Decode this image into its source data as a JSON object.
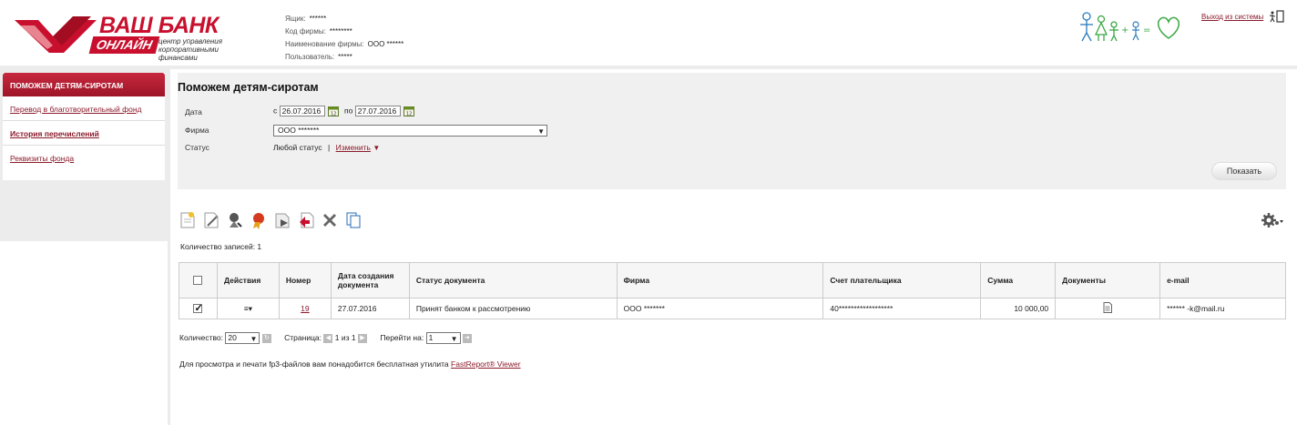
{
  "header": {
    "brand": "ВАШ БАНК",
    "brand_online": "ОНЛАЙН",
    "brand_sub": [
      "центр управления",
      "корпоративными",
      "финансами"
    ],
    "info": [
      {
        "label": "Ящик:",
        "value": "******"
      },
      {
        "label": "Код фирмы:",
        "value": "********"
      },
      {
        "label": "Наименование фирмы:",
        "value": "ООО ******"
      },
      {
        "label": "Пользователь:",
        "value": "*****"
      }
    ],
    "logout": "Выход из системы",
    "logout_icon": "exit-door-icon",
    "charity_logo": "children-charity-logo"
  },
  "sidebar": {
    "title": "ПОМОЖЕМ ДЕТЯМ-СИРОТАМ",
    "items": [
      {
        "label": "Перевод в благотворительный фонд",
        "active": false
      },
      {
        "label": "История перечислений",
        "active": true
      },
      {
        "label": "Реквизиты фонда",
        "active": false
      }
    ]
  },
  "filter": {
    "title": "Поможем детям-сиротам",
    "date_label": "Дата",
    "from_prefix": "с",
    "date_from": "26.07.2016",
    "to_prefix": "по",
    "date_to": "27.07.2016",
    "firm_label": "Фирма",
    "firm_value": "ООО *******",
    "status_label": "Статус",
    "status_value": "Любой статус",
    "status_sep": "|",
    "status_change": "Изменить",
    "show_button": "Показать"
  },
  "toolbar": {
    "icons": [
      "new-document-icon",
      "edit-document-icon",
      "sign-icon",
      "certificate-icon",
      "send-icon",
      "import-icon",
      "delete-icon",
      "copy-icon"
    ],
    "settings_icon": "gear-icon"
  },
  "records_count": "Количество записей: 1",
  "table": {
    "columns": [
      "",
      "Действия",
      "Номер",
      "Дата создания документа",
      "Статус документа",
      "Фирма",
      "Счет плательщика",
      "Сумма",
      "Документы",
      "e-mail"
    ],
    "rows": [
      {
        "checked": true,
        "actions": "≡▾",
        "number": "19",
        "created": "27.07.2016",
        "status": "Принят банком к рассмотрению",
        "firm": "ООО *******",
        "account": "40******************",
        "amount": "10 000,00",
        "document_icon": "document-icon",
        "email": "****** -k@mail.ru"
      }
    ]
  },
  "pager": {
    "count_label": "Количество:",
    "count_value": "20",
    "page_label": "Страница:",
    "page_text": "1 из 1",
    "goto_label": "Перейти на:",
    "goto_value": "1"
  },
  "footer_note": {
    "text": "Для просмотра и печати fp3-файлов вам понадобится бесплатная утилита",
    "link": "FastReport® Viewer"
  },
  "colors": {
    "brand_red": "#c8102e",
    "link": "#8b1a2b"
  }
}
